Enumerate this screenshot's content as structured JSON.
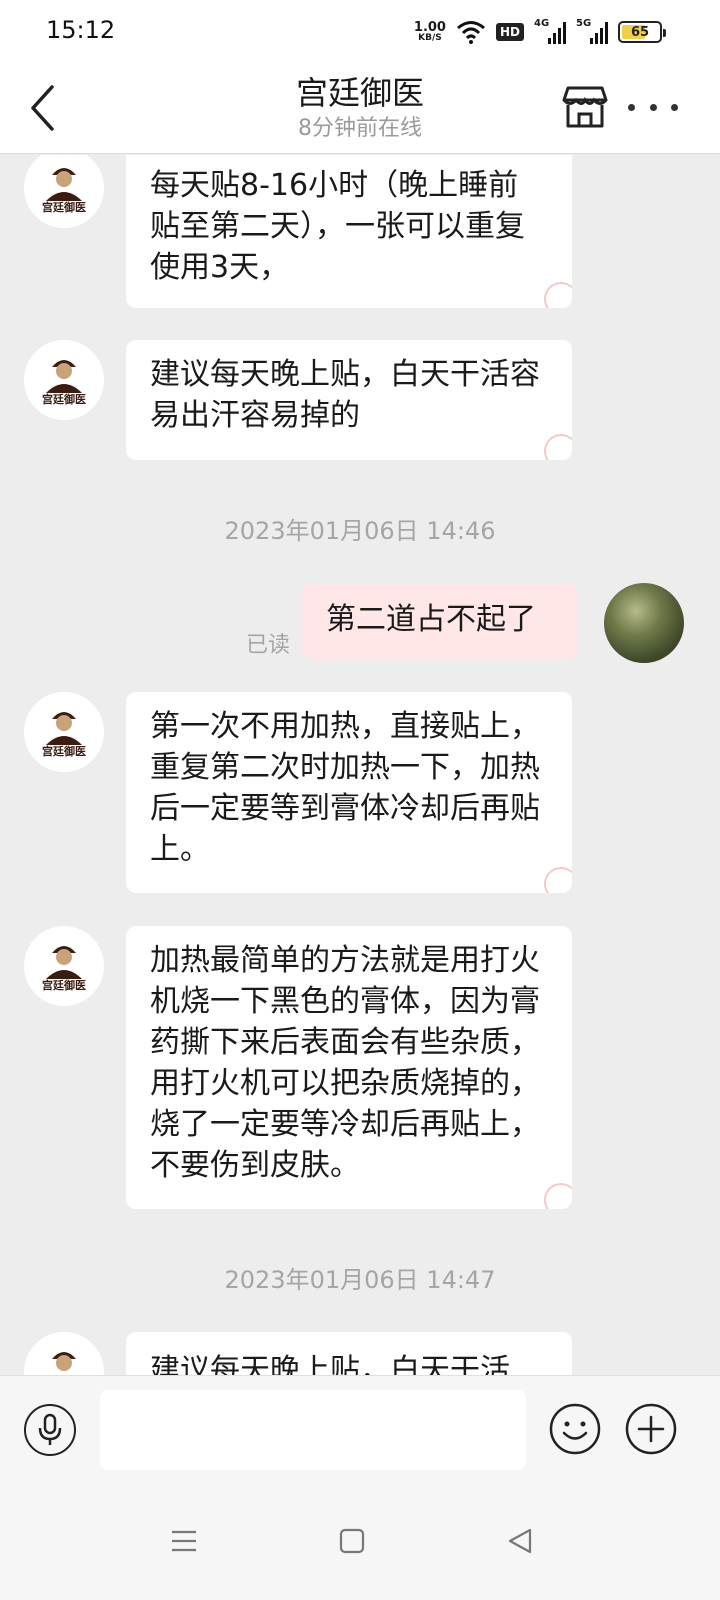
{
  "status_bar": {
    "time": "15:12",
    "net_speed_value": "1.00",
    "net_speed_unit": "KB/S",
    "hd_label": "HD",
    "signal1_label": "4G",
    "signal2_label": "5G",
    "battery_level": "65"
  },
  "header": {
    "title": "宫廷御医",
    "subtitle": "8分钟前在线"
  },
  "brand": {
    "avatar_text": "宫廷御医"
  },
  "chat": {
    "messages": [
      {
        "from": "shop",
        "text": "每天贴8-16小时（晚上睡前贴至第二天），一张可以重复使用3天，"
      },
      {
        "from": "shop",
        "text": "建议每天晚上贴，白天干活容易出汗容易掉的"
      },
      {
        "from": "me",
        "text": "第二道占不起了",
        "status": "已读"
      },
      {
        "from": "shop",
        "text": "第一次不用加热，直接贴上，重复第二次时加热一下，加热后一定要等到膏体冷却后再贴上。"
      },
      {
        "from": "shop",
        "text": "加热最简单的方法就是用打火机烧一下黑色的膏体，因为膏药撕下来后表面会有些杂质，用打火机可以把杂质烧掉的，烧了一定要等冷却后再贴上，不要伤到皮肤。"
      },
      {
        "from": "shop",
        "text": "建议每天晚上贴，白天干活"
      }
    ],
    "timestamps": [
      "2023年01月06日 14:46",
      "2023年01月06日 14:47"
    ]
  },
  "input": {
    "placeholder": "",
    "value": ""
  },
  "colors": {
    "page_bg": "#ededed",
    "my_bubble": "#ffe7e7",
    "their_bubble": "#ffffff",
    "battery": "#f2cf4a"
  },
  "icons": {
    "back": "chevron-left-icon",
    "shop": "store-icon",
    "more": "more-dots-icon",
    "voice": "microphone-icon",
    "emoji": "smiley-icon",
    "plus": "plus-circle-icon",
    "nav_menu": "menu-lines-icon",
    "nav_home": "square-icon",
    "nav_back": "triangle-back-icon"
  }
}
